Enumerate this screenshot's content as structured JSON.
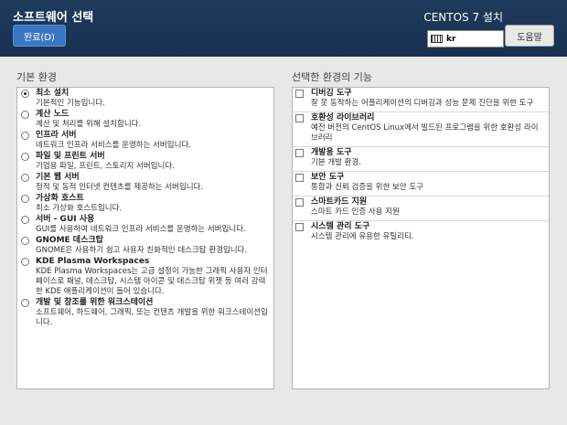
{
  "header": {
    "title": "소프트웨어 선택",
    "done_label": "완료(D)",
    "install_title": "CENTOS 7 설치",
    "keyboard_layout": "kr",
    "help_label": "도움말"
  },
  "base_env": {
    "label": "기본 환경",
    "items": [
      {
        "title": "최소 설치",
        "desc": "기본적인 기능입니다.",
        "selected": true
      },
      {
        "title": "계산 노드",
        "desc": "계산 및 처리를 위해 설치합니다."
      },
      {
        "title": "인프라 서버",
        "desc": "네트워크 인프라 서비스를 운영하는 서버입니다."
      },
      {
        "title": "파일 및 프린트 서버",
        "desc": "기업용 파일, 프린트, 스토리지 서버입니다."
      },
      {
        "title": "기본 웹 서버",
        "desc": "정적 및 동적 인터넷 컨텐츠를 제공하는 서버입니다."
      },
      {
        "title": "가상화 호스트",
        "desc": "최소 가상화 호스트입니다."
      },
      {
        "title": "서버 - GUI 사용",
        "desc": "GUI를 사용하여 네트워크 인프라 서비스를 운영하는 서버입니다."
      },
      {
        "title": "GNOME 데스크탑",
        "desc": "GNOME은 사용하기 쉽고 사용자 친화적인 데스크탑 환경입니다."
      },
      {
        "title": "KDE Plasma Workspaces",
        "desc": "KDE Plasma Workspaces는 고급 설정이 가능한 그래픽 사용자 인터페이스로 패널, 데스크탑, 시스템 아이콘 및 데스크탑 위젯 등 여러 강력한 KDE 애플리케이션이 들어 있습니다."
      },
      {
        "title": "개발 및 창조를 위한 워크스테이션",
        "desc": "소프트웨어, 하드웨어, 그래픽, 또는 컨텐츠 개발을 위한 워크스테이션입니다."
      }
    ]
  },
  "addons": {
    "label": "선택한 환경의 기능",
    "items": [
      {
        "title": "디버깅 도구",
        "desc": "잘 못 동작하는 어플리케이션의 디버깅과 성능 문제 진단을 위한 도구"
      },
      {
        "title": "호환성 라이브러리",
        "desc": "예전 버전의 CentOS Linux에서 빌드된 프로그램을 위한 호환성 라이브러리"
      },
      {
        "title": "개발용 도구",
        "desc": "기본 개발 환경."
      },
      {
        "title": "보안 도구",
        "desc": "통합과 신뢰 검증을 위한 보안 도구"
      },
      {
        "title": "스마트카드 지원",
        "desc": "스마트 카드 인증 사용 지원"
      },
      {
        "title": "시스템 관리 도구",
        "desc": "시스템 관리에 유용한 유틸리티."
      }
    ]
  }
}
